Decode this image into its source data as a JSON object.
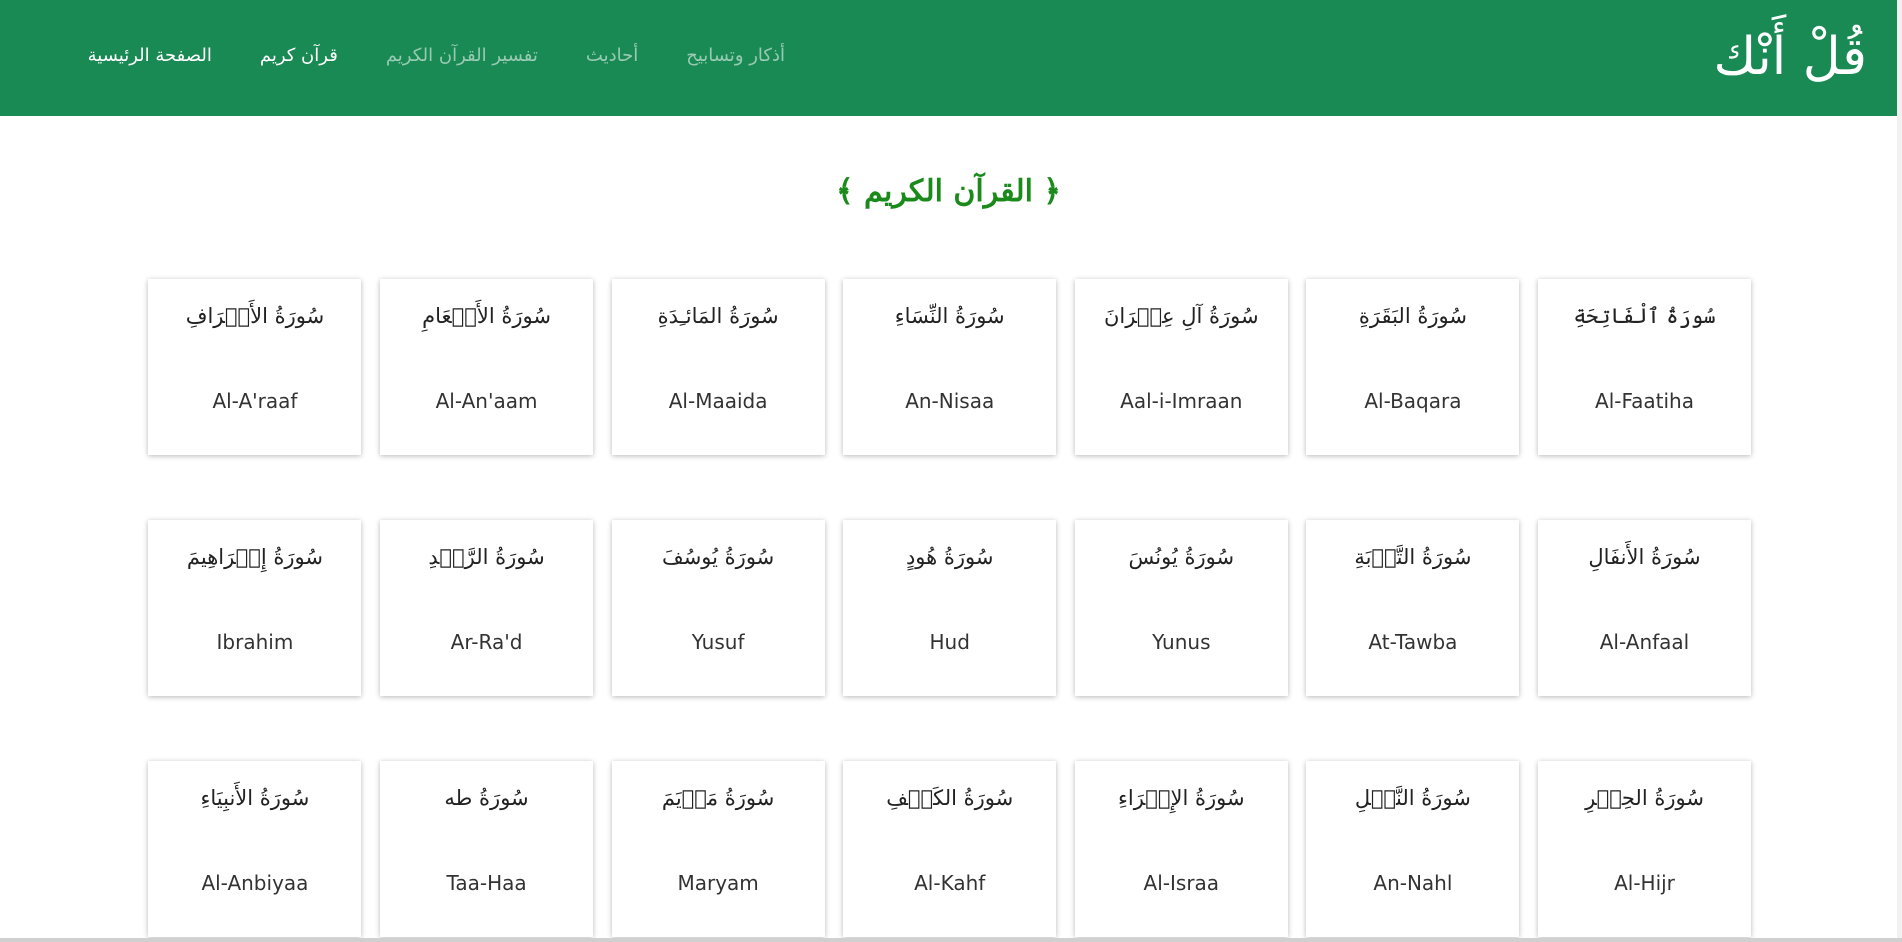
{
  "brand": {
    "logo_text": "قُلْ أَنْك"
  },
  "nav": {
    "items": [
      {
        "label": "الصفحة الرئيسية",
        "active": true
      },
      {
        "label": "قرآن كريم",
        "active": true
      },
      {
        "label": "تفسير القرآن الكريم",
        "active": false
      },
      {
        "label": "أحاديث",
        "active": false
      },
      {
        "label": "أذكار وتسابيح",
        "active": false
      }
    ]
  },
  "page": {
    "title": "﴿ القرآن الكريم ﴾"
  },
  "colors": {
    "brand_green": "#1a8a55",
    "title_green": "#1a8a1a"
  },
  "surahs": [
    {
      "arabic": "سُورَةُ ٱلْفَاتِحَةِ",
      "english": "Al-Faatiha"
    },
    {
      "arabic": "سُورَةُ البَقَرَةِ",
      "english": "Al-Baqara"
    },
    {
      "arabic": "سُورَةُ آلِ عِمۡرَانَ",
      "english": "Aal-i-Imraan"
    },
    {
      "arabic": "سُورَةُ النِّسَاءِ",
      "english": "An-Nisaa"
    },
    {
      "arabic": "سُورَةُ المَائـِدَةِ",
      "english": "Al-Maaida"
    },
    {
      "arabic": "سُورَةُ الأَنۡعَامِ",
      "english": "Al-An'aam"
    },
    {
      "arabic": "سُورَةُ الأَعۡرَافِ",
      "english": "Al-A'raaf"
    },
    {
      "arabic": "سُورَةُ الأَنفَالِ",
      "english": "Al-Anfaal"
    },
    {
      "arabic": "سُورَةُ التَّوۡبَةِ",
      "english": "At-Tawba"
    },
    {
      "arabic": "سُورَةُ يُونُسَ",
      "english": "Yunus"
    },
    {
      "arabic": "سُورَةُ هُودٍ",
      "english": "Hud"
    },
    {
      "arabic": "سُورَةُ يُوسُفَ",
      "english": "Yusuf"
    },
    {
      "arabic": "سُورَةُ الرَّعۡدِ",
      "english": "Ar-Ra'd"
    },
    {
      "arabic": "سُورَةُ إِبۡرَاهِيمَ",
      "english": "Ibrahim"
    },
    {
      "arabic": "سُورَةُ الحِجۡرِ",
      "english": "Al-Hijr"
    },
    {
      "arabic": "سُورَةُ النَّحۡلِ",
      "english": "An-Nahl"
    },
    {
      "arabic": "سُورَةُ الإِسۡرَاءِ",
      "english": "Al-Israa"
    },
    {
      "arabic": "سُورَةُ الكَهۡفِ",
      "english": "Al-Kahf"
    },
    {
      "arabic": "سُورَةُ مَرۡيَمَ",
      "english": "Maryam"
    },
    {
      "arabic": "سُورَةُ طه",
      "english": "Taa-Haa"
    },
    {
      "arabic": "سُورَةُ الأَنبِيَاءِ",
      "english": "Al-Anbiyaa"
    }
  ]
}
